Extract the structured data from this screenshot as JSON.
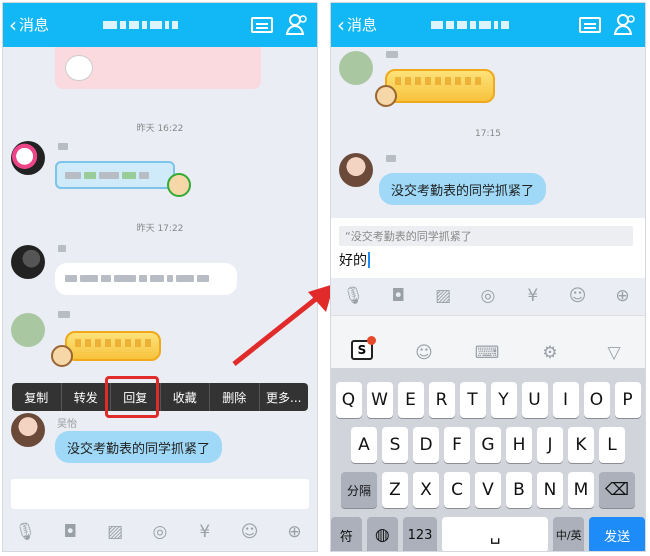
{
  "left": {
    "back_label": "消息",
    "time1": "昨天 16:22",
    "time2": "昨天 17:22",
    "context_menu": [
      "复制",
      "转发",
      "回复",
      "收藏",
      "删除",
      "更多..."
    ],
    "sender_name": "吴怡",
    "message": "没交考勤表的同学抓紧了"
  },
  "right": {
    "back_label": "消息",
    "time": "17:15",
    "message": "没交考勤表的同学抓紧了",
    "quote": "“没交考勤表的同学抓紧了",
    "input_value": "好的",
    "keyboard_row1": [
      "Q",
      "W",
      "E",
      "R",
      "T",
      "Y",
      "U",
      "I",
      "O",
      "P"
    ],
    "keyboard_row2": [
      "A",
      "S",
      "D",
      "F",
      "G",
      "H",
      "J",
      "K",
      "L"
    ],
    "keyboard_row3": [
      "Z",
      "X",
      "C",
      "V",
      "B",
      "N",
      "M"
    ],
    "shift_label": "分隔",
    "symbol_label": "符",
    "num_label": "123",
    "lang_label": "中/英",
    "send_label": "发送",
    "sogou_label": "S"
  },
  "colors": {
    "navbar": "#12b7f5",
    "highlight": "#e12b2b",
    "bubble": "#9fd9f7",
    "send": "#1d8cf8"
  },
  "icons": [
    "voice-icon",
    "video-icon",
    "image-icon",
    "camera-icon",
    "redpacket-icon",
    "emoji-icon",
    "plus-icon"
  ]
}
